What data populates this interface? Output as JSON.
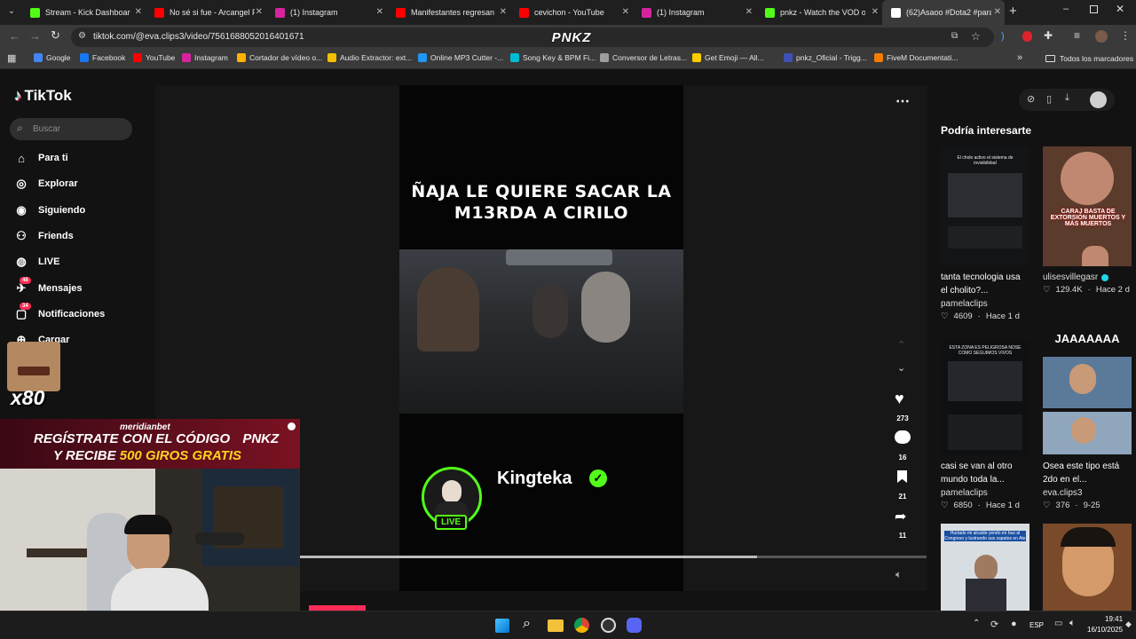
{
  "tabs": [
    {
      "title": "Stream - Kick Dashboard",
      "color": "#53fc18"
    },
    {
      "title": "No sé si fue - Arcangel Fe",
      "color": "#ff0000"
    },
    {
      "title": "(1) Instagram",
      "color": "#d6249f"
    },
    {
      "title": "Manifestantes regresan al",
      "color": "#ff0000"
    },
    {
      "title": "cevichon - YouTube",
      "color": "#ff0000"
    },
    {
      "title": "(1) Instagram",
      "color": "#d6249f"
    },
    {
      "title": "pnkz - Watch the VOD on",
      "color": "#53fc18"
    },
    {
      "title": "(62)Asaoo #Dota2 #para",
      "color": "#ffffff"
    }
  ],
  "address": {
    "url": "tiktok.com/@eva.clips3/video/7561688052016401671"
  },
  "overlay_logo": "PNKZ",
  "bookmarks": [
    {
      "label": "Google",
      "color": "#4285f4"
    },
    {
      "label": "Facebook",
      "color": "#1877f2"
    },
    {
      "label": "YouTube",
      "color": "#ff0000"
    },
    {
      "label": "Instagram",
      "color": "#d6249f"
    },
    {
      "label": "Cortador de vídeo o...",
      "color": "#ffb300"
    },
    {
      "label": "Audio Extractor: ext...",
      "color": "#f5c000"
    },
    {
      "label": "Online MP3 Cutter -...",
      "color": "#2196f3"
    },
    {
      "label": "Song Key & BPM Fi...",
      "color": "#00bcd4"
    },
    {
      "label": "Conversor de Letras...",
      "color": "#9e9e9e"
    },
    {
      "label": "Get Emoji — All...",
      "color": "#ffcc00"
    },
    {
      "label": "pnkz_Oficial - Trigg...",
      "color": "#3f51b5"
    },
    {
      "label": "FiveM Documentati...",
      "color": "#f57c00"
    }
  ],
  "bookmarks_all": "Todos los marcadores",
  "tiktok": {
    "logo": "TikTok",
    "search_placeholder": "Buscar",
    "nav": [
      {
        "label": "Para ti",
        "icon": "home-icon"
      },
      {
        "label": "Explorar",
        "icon": "compass-icon"
      },
      {
        "label": "Siguiendo",
        "icon": "following-icon"
      },
      {
        "label": "Friends",
        "icon": "friends-icon"
      },
      {
        "label": "LIVE",
        "icon": "live-icon"
      },
      {
        "label": "Mensajes",
        "icon": "message-icon",
        "badge": "48"
      },
      {
        "label": "Notificaciones",
        "icon": "bell-icon",
        "badge": "34"
      },
      {
        "label": "Cargar",
        "icon": "upload-icon"
      }
    ]
  },
  "video": {
    "caption": "ÑAJA LE QUIERE SACAR LA M13RDA A CIRILO",
    "streamer_name": "Kingteka",
    "live_label": "LIVE",
    "likes": "273",
    "comments": "16",
    "saves": "21",
    "shares": "11",
    "progress": 0.73
  },
  "recommend": {
    "title": "Podría interesarte",
    "cards": [
      {
        "title": "tanta tecnologia usa el cholito?...",
        "author": "pamelaclips",
        "likes": "4609",
        "age": "Hace 1 d",
        "thumb_text": "El cholo activo el sistema de invisibilidad"
      },
      {
        "title": "",
        "author": "ulisesvillegasr",
        "likes": "129.4K",
        "age": "Hace 2 d",
        "thumb_text": "CARAJ BASTA DE EXTORSIÓN MUERTOS Y MÁS MUERTOS"
      },
      {
        "title": "casi se van al otro mundo toda la...",
        "author": "pamelaclips",
        "likes": "6850",
        "age": "Hace 1 d",
        "thumb_text": "ESTA ZONA ES PELIGROSA NOSE COMO SEGUIMOS VIVOS"
      },
      {
        "title": "Osea este tipo está 2do en el...",
        "author": "eva.clips3",
        "likes": "376",
        "age": "9-25",
        "thumb_text": "JAAAAAAA"
      },
      {
        "title": "",
        "author": "",
        "likes": "",
        "age": "",
        "thumb_text": "Hurtado mi alcalde yendo en bus al Congreso y lustrando sus zapatos en Ate"
      }
    ]
  },
  "stream_overlay": {
    "sponsor": "meridianbet",
    "promo_line1": "REGÍSTRATE CON EL CÓDIGO",
    "promo_code": "PNKZ",
    "promo_line2_pre": "Y RECIBE",
    "promo_line2_hi": "500 GIROS GRATIS",
    "emote_count": "x80"
  },
  "taskbar": {
    "lang": "ESP",
    "time": "19:41",
    "date": "16/10/2025"
  }
}
